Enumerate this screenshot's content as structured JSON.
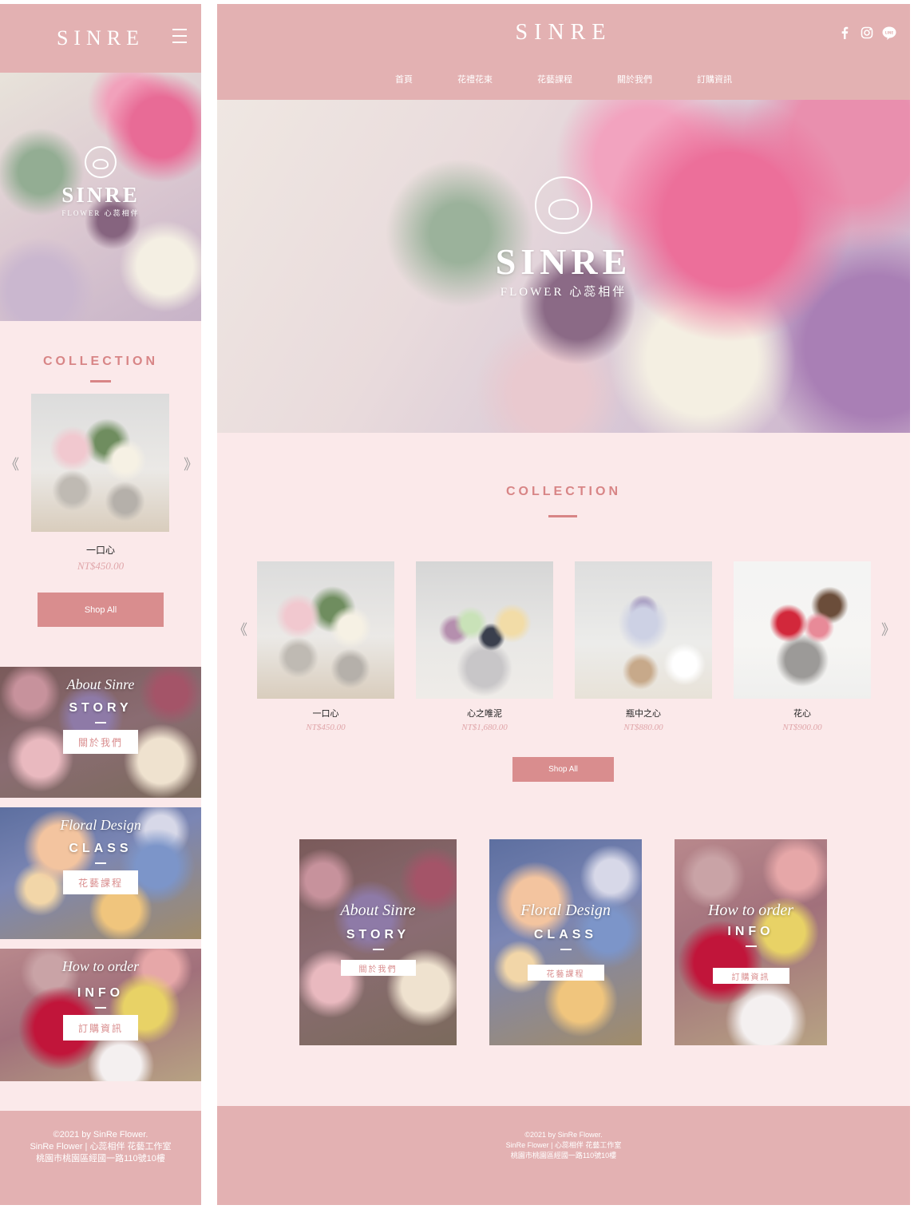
{
  "brand": {
    "name": "SINRE",
    "hero_name": "SINRE",
    "hero_sub": "FLOWER 心蕊相伴"
  },
  "colors": {
    "header": "#e3b1b2",
    "background": "#fbe9ea",
    "accent": "#d98d8e",
    "price": "#e0a6aa"
  },
  "nav": [
    "首頁",
    "花禮花束",
    "花藝課程",
    "關於我們",
    "訂購資訊"
  ],
  "social_icons": [
    "facebook-icon",
    "instagram-icon",
    "line-icon"
  ],
  "social_line_text": "LINE",
  "collection": {
    "title": "COLLECTION",
    "products": [
      {
        "name": "一口心",
        "price": "NT$450.00"
      },
      {
        "name": "心之唯泥",
        "price": "NT$1,680.00"
      },
      {
        "name": "瓶中之心",
        "price": "NT$880.00"
      },
      {
        "name": "花心",
        "price": "NT$900.00"
      }
    ],
    "shop_all": "Shop All",
    "prev": "《",
    "next": "》"
  },
  "tiles": [
    {
      "script": "About Sinre",
      "heading": "STORY",
      "button": "關於我們"
    },
    {
      "script": "Floral Design",
      "heading": "CLASS",
      "button": "花藝課程"
    },
    {
      "script": "How to order",
      "heading": "INFO",
      "button": "訂購資訊"
    }
  ],
  "footer": {
    "line1": "©2021 by SinRe Flower.",
    "line2": "SinRe Flower | 心蕊相伴 花藝工作室",
    "line3": "桃園市桃園區經國一路110號10樓"
  }
}
